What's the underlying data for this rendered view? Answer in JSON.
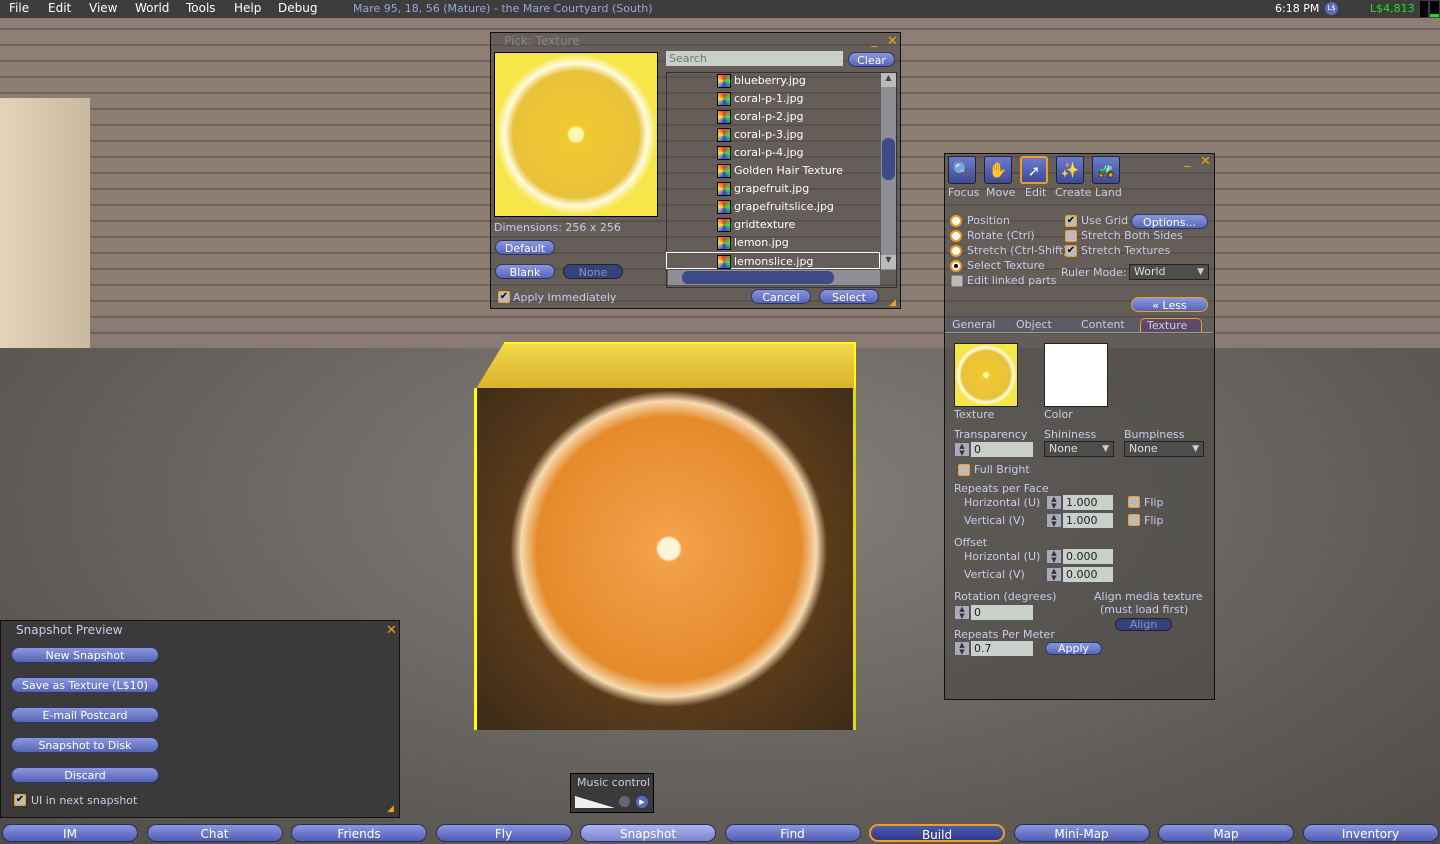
{
  "menubar": {
    "items": [
      "File",
      "Edit",
      "View",
      "World",
      "Tools",
      "Help",
      "Debug"
    ],
    "location": "Mare 95, 18, 56 (Mature) - the Mare Courtyard (South)",
    "time": "6:18 PM",
    "currency_icon": "L$",
    "balance": "L$4,813"
  },
  "texture_picker": {
    "title": "Pick: Texture",
    "search_placeholder": "Search",
    "clear": "Clear",
    "dimensions": "Dimensions: 256 x 256",
    "default": "Default",
    "blank": "Blank",
    "none": "None",
    "apply_immediately": "Apply Immediately",
    "cancel": "Cancel",
    "select": "Select",
    "items": [
      "blueberry.jpg",
      "coral-p-1.jpg",
      "coral-p-2.jpg",
      "coral-p-3.jpg",
      "coral-p-4.jpg",
      "Golden Hair Texture",
      "grapefruit.jpg",
      "grapefruitslice.jpg",
      "gridtexture",
      "lemon.jpg",
      "lemonslice.jpg"
    ],
    "selected": "lemonslice.jpg"
  },
  "build": {
    "tools": [
      "Focus",
      "Move",
      "Edit",
      "Create",
      "Land"
    ],
    "active_tool": "Edit",
    "radios": [
      "Position",
      "Rotate (Ctrl)",
      "Stretch (Ctrl-Shift)",
      "Select Texture"
    ],
    "selected_radio": "Select Texture",
    "edit_linked": "Edit linked parts",
    "use_grid": "Use Grid",
    "options": "Options...",
    "stretch_both": "Stretch Both Sides",
    "stretch_textures": "Stretch Textures",
    "ruler_mode_label": "Ruler Mode:",
    "ruler_mode": "World",
    "less": "« Less",
    "tabs": [
      "General",
      "Object",
      "Content",
      "Texture"
    ],
    "active_tab": "Texture",
    "texture_label": "Texture",
    "color_label": "Color",
    "transparency_label": "Transparency",
    "transparency": "0",
    "shininess_label": "Shininess",
    "shininess": "None",
    "bumpiness_label": "Bumpiness",
    "bumpiness": "None",
    "full_bright": "Full Bright",
    "repeats_label": "Repeats per Face",
    "horizontal": "Horizontal (U)",
    "vertical": "Vertical (V)",
    "rep_h": "1.000",
    "rep_v": "1.000",
    "flip": "Flip",
    "offset_label": "Offset",
    "off_h": "0.000",
    "off_v": "0.000",
    "rotation_label": "Rotation (degrees)",
    "rotation": "0",
    "align_media": "Align media texture",
    "must_load": "(must load first)",
    "align": "Align",
    "rpm_label": "Repeats Per Meter",
    "rpm": "0.7",
    "apply": "Apply"
  },
  "snapshot": {
    "title": "Snapshot Preview",
    "buttons": [
      "New Snapshot",
      "Save as Texture (L$10)",
      "E-mail Postcard",
      "Snapshot to Disk",
      "Discard"
    ],
    "ui_in_snapshot": "UI in next snapshot"
  },
  "music": {
    "title": "Music control"
  },
  "bottombar": [
    "IM",
    "Chat",
    "Friends",
    "Fly",
    "Snapshot",
    "Find",
    "Build",
    "Mini-Map",
    "Map",
    "Inventory"
  ]
}
